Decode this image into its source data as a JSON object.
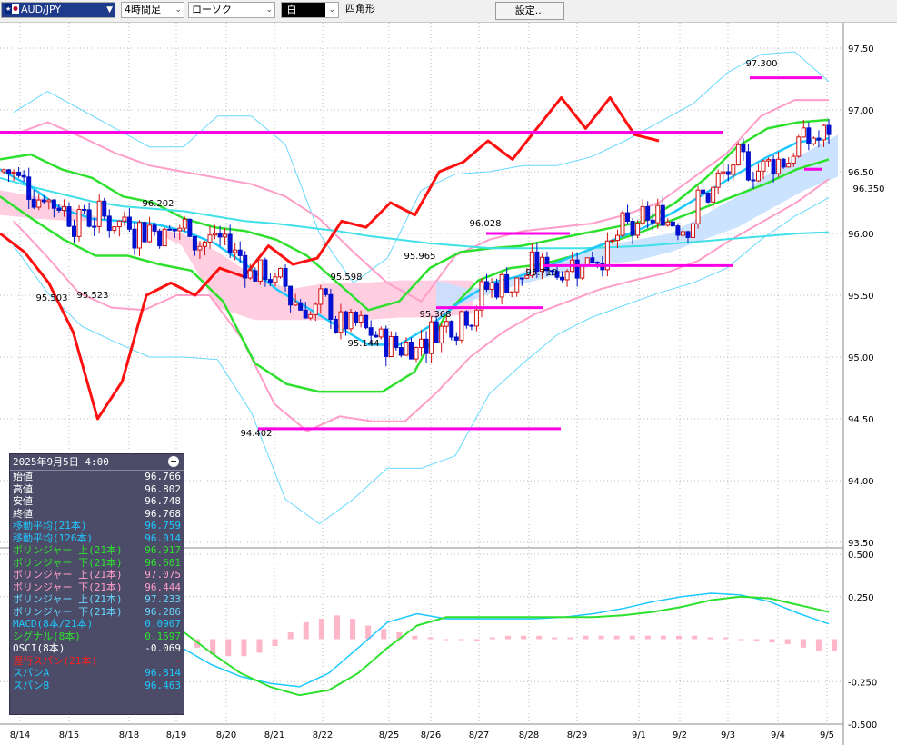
{
  "toolbar": {
    "pair": "AUD/JPY",
    "timeframe": "4時間足",
    "chart_type": "ローソク",
    "color_label": "白",
    "shape": "四角形",
    "settings": "設定..."
  },
  "info_panel": {
    "datetime": "2025年9月5日 4:00",
    "rows": [
      {
        "label": "始値",
        "value": "96.766",
        "color": "#ffffff"
      },
      {
        "label": "高値",
        "value": "96.802",
        "color": "#ffffff"
      },
      {
        "label": "安値",
        "value": "96.748",
        "color": "#ffffff"
      },
      {
        "label": "終値",
        "value": "96.768",
        "color": "#ffffff"
      },
      {
        "label": "移動平均(21本)",
        "value": "96.759",
        "color": "#1ec8ff"
      },
      {
        "label": "移動平均(126本)",
        "value": "96.014",
        "color": "#1ec8ff"
      },
      {
        "label": "ボリンジャー 上(21本)",
        "value": "96.917",
        "color": "#2ee02e"
      },
      {
        "label": "ボリンジャー 下(21本)",
        "value": "96.601",
        "color": "#2ee02e"
      },
      {
        "label": "ボリンジャー 上(21本)",
        "value": "97.075",
        "color": "#ff9ec8"
      },
      {
        "label": "ボリンジャー 下(21本)",
        "value": "96.444",
        "color": "#ff9ec8"
      },
      {
        "label": "ボリンジャー 上(21本)",
        "value": "97.233",
        "color": "#68d8ff"
      },
      {
        "label": "ボリンジャー 下(21本)",
        "value": "96.286",
        "color": "#68d8ff"
      },
      {
        "label": "MACD(8本/21本)",
        "value": "0.0907",
        "color": "#1ec8ff"
      },
      {
        "label": "シグナル(8本)",
        "value": "0.1597",
        "color": "#2ee02e"
      },
      {
        "label": "OSCI(8本)",
        "value": "-0.069",
        "color": "#ffffff"
      },
      {
        "label": "遅行スパン(21本)",
        "value": "-",
        "color": "#ff2020"
      },
      {
        "label": "スパンA",
        "value": "96.814",
        "color": "#1ec8ff"
      },
      {
        "label": "スパンB",
        "value": "96.463",
        "color": "#1ec8ff"
      }
    ]
  },
  "chart_data": {
    "type": "candlestick",
    "price_axis": {
      "ticks": [
        "97.50",
        "97.00",
        "96.50",
        "96.00",
        "95.50",
        "95.00",
        "94.50",
        "94.00",
        "93.50"
      ],
      "min": 93.5,
      "max": 97.5
    },
    "indicator_axis": {
      "ticks": [
        "0.500",
        "0.250",
        "-0.250",
        "-0.500"
      ],
      "min": -0.5,
      "max": 0.5
    },
    "x_labels": [
      "8/14",
      "8/15",
      "8/18",
      "8/19",
      "8/20",
      "8/21",
      "8/22",
      "8/25",
      "8/26",
      "8/27",
      "8/28",
      "8/29",
      "9/1",
      "9/2",
      "9/3",
      "9/4",
      "9/5"
    ],
    "annotations": [
      "97.300",
      "96.350",
      "96.202",
      "95.965",
      "96.028",
      "95.598",
      "95.710",
      "95.503",
      "95.523",
      "95.368",
      "95.144",
      "94.402"
    ],
    "horizontal_lines": [
      96.82,
      97.26,
      96.52,
      96.0,
      95.74,
      95.4,
      94.42
    ],
    "series": [
      {
        "name": "移動平均(21本)",
        "color": "#1ec8ff",
        "values": [
          96.52,
          96.38,
          96.2,
          96.12,
          96.1,
          96.08,
          96.02,
          95.92,
          95.75,
          95.55,
          95.4,
          95.25,
          95.1,
          95.1,
          95.25,
          95.45,
          95.6,
          95.66,
          95.75,
          95.85,
          95.95,
          96.05,
          96.18,
          96.33,
          96.48,
          96.62,
          96.74,
          96.77
        ]
      },
      {
        "name": "移動平均(126本)",
        "color": "#40e0e8",
        "values": [
          96.45,
          96.38,
          96.32,
          96.26,
          96.22,
          96.2,
          96.18,
          96.14,
          96.1,
          96.08,
          96.05,
          96.02,
          95.98,
          95.95,
          95.92,
          95.9,
          95.88,
          95.88,
          95.88,
          95.88,
          95.89,
          95.9,
          95.92,
          95.94,
          95.96,
          95.98,
          96.0,
          96.01
        ]
      },
      {
        "name": "ボリンジャー 上(21本)",
        "color": "#2ee02e",
        "values": [
          96.6,
          96.64,
          96.52,
          96.45,
          96.3,
          96.25,
          96.12,
          96.05,
          96.02,
          95.95,
          95.82,
          95.6,
          95.38,
          95.45,
          95.72,
          95.85,
          95.88,
          95.9,
          95.95,
          96.0,
          96.05,
          96.1,
          96.25,
          96.45,
          96.7,
          96.85,
          96.9,
          96.92
        ]
      },
      {
        "name": "ボリンジャー 下(21本)",
        "color": "#2ee02e",
        "values": [
          96.3,
          96.12,
          95.95,
          95.82,
          95.82,
          95.75,
          95.7,
          95.45,
          94.95,
          94.78,
          94.72,
          94.72,
          94.72,
          94.88,
          95.35,
          95.62,
          95.72,
          95.75,
          95.82,
          95.92,
          96.0,
          96.1,
          96.2,
          96.3,
          96.4,
          96.52,
          96.6
        ]
      },
      {
        "name": "ボリンジャー 上(21本)",
        "color": "#ff9ec8",
        "values": [
          96.8,
          96.9,
          96.78,
          96.65,
          96.55,
          96.5,
          96.45,
          96.4,
          96.3,
          96.12,
          95.85,
          95.6,
          95.45,
          95.82,
          95.95,
          96.02,
          96.05,
          96.08,
          96.15,
          96.25,
          96.45,
          96.65,
          96.95,
          97.08,
          97.08
        ]
      },
      {
        "name": "ボリンジャー 下(21本)",
        "color": "#ff9ec8",
        "values": [
          96.1,
          95.82,
          95.52,
          95.4,
          95.38,
          95.5,
          95.5,
          95.15,
          94.62,
          94.4,
          94.52,
          94.48,
          94.48,
          94.72,
          95.0,
          95.2,
          95.35,
          95.45,
          95.55,
          95.62,
          95.68,
          95.78,
          95.95,
          96.1,
          96.25,
          96.44
        ]
      },
      {
        "name": "ボリンジャー 上(21本)",
        "color": "#68d8ff",
        "values": [
          96.98,
          97.15,
          97.0,
          96.85,
          96.7,
          96.7,
          96.95,
          96.95,
          96.72,
          96.0,
          95.6,
          95.8,
          96.35,
          96.48,
          96.5,
          96.55,
          96.55,
          96.62,
          96.75,
          96.9,
          97.05,
          97.3,
          97.45,
          97.47,
          97.23
        ]
      },
      {
        "name": "ボリンジャー 下(21本)",
        "color": "#68d8ff",
        "values": [
          95.9,
          95.52,
          95.25,
          95.12,
          95.0,
          95.0,
          94.98,
          94.55,
          93.85,
          93.65,
          93.85,
          94.1,
          94.1,
          94.2,
          94.7,
          94.95,
          95.18,
          95.32,
          95.42,
          95.52,
          95.6,
          95.72,
          95.95,
          96.14,
          96.29
        ]
      },
      {
        "name": "遅行スパン(21本)",
        "color": "#ff1010",
        "values": [
          96.0,
          95.85,
          95.6,
          95.2,
          94.5,
          94.8,
          95.5,
          95.6,
          95.5,
          95.72,
          95.65,
          95.9,
          95.75,
          95.8,
          96.1,
          96.05,
          96.25,
          96.15,
          96.5,
          96.58,
          96.75,
          96.6,
          96.85,
          97.1,
          96.85,
          97.1,
          96.8,
          96.75
        ]
      }
    ],
    "macd": {
      "name": "MACD(8本/21本)",
      "color": "#1ec8ff",
      "values": [
        -0.05,
        -0.15,
        -0.22,
        -0.26,
        -0.28,
        -0.2,
        -0.05,
        0.1,
        0.15,
        0.12,
        0.12,
        0.12,
        0.12,
        0.13,
        0.15,
        0.18,
        0.22,
        0.25,
        0.27,
        0.26,
        0.22,
        0.15,
        0.09
      ]
    },
    "signal": {
      "name": "シグナル(8本)",
      "color": "#2ee02e",
      "values": [
        0.05,
        -0.08,
        -0.2,
        -0.28,
        -0.33,
        -0.3,
        -0.2,
        -0.05,
        0.08,
        0.13,
        0.13,
        0.13,
        0.13,
        0.13,
        0.13,
        0.14,
        0.16,
        0.19,
        0.23,
        0.25,
        0.24,
        0.2,
        0.16
      ]
    },
    "osci": {
      "name": "OSCI(8本)",
      "values": [
        -0.03,
        -0.05,
        -0.09,
        -0.1,
        -0.1,
        -0.08,
        -0.04,
        0.04,
        0.1,
        0.12,
        0.14,
        0.12,
        0.08,
        0.06,
        0.04,
        0.02,
        0.01,
        0.0,
        0.0,
        -0.01,
        0.01,
        0.02,
        0.02,
        0.02,
        0.01,
        0.01,
        0.02,
        0.02,
        0.02,
        0.02,
        0.02,
        0.02,
        0.02,
        0.02,
        0.01,
        0.01,
        0.0,
        -0.01,
        -0.02,
        -0.03,
        -0.05,
        -0.07,
        -0.07
      ]
    }
  }
}
